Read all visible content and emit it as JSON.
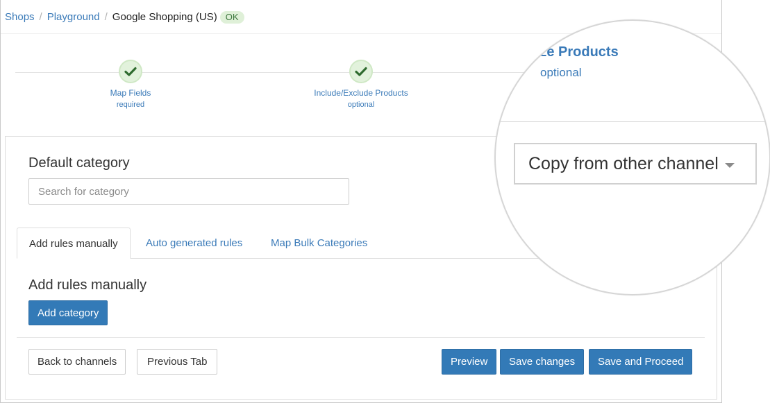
{
  "breadcrumb": {
    "items": [
      "Shops",
      "Playground"
    ],
    "separator": "/",
    "current": "Google Shopping (US)",
    "status_badge": "OK"
  },
  "steps": [
    {
      "label": "Map Fields",
      "sub": "required",
      "status": "complete",
      "icon": "check-icon"
    },
    {
      "label": "Include/Exclude Products",
      "sub": "optional",
      "status": "complete",
      "icon": "check-icon"
    }
  ],
  "magnifier": {
    "step_title": "rize Products",
    "step_sub": "optional",
    "copy_dropdown": "Copy from other channel"
  },
  "category": {
    "title": "Default category",
    "search_placeholder": "Search for category"
  },
  "tabs": [
    {
      "label": "Add rules manually",
      "active": true
    },
    {
      "label": "Auto generated rules",
      "active": false
    },
    {
      "label": "Map Bulk Categories",
      "active": false
    }
  ],
  "rules": {
    "title": "Add rules manually",
    "add_button": "Add category"
  },
  "footer": {
    "back": "Back to channels",
    "previous": "Previous Tab",
    "preview": "Preview",
    "save": "Save changes",
    "save_proceed": "Save and Proceed"
  },
  "colors": {
    "link": "#3a7ab8",
    "primary": "#337ab7",
    "success_bg": "#dff0d8",
    "success_text": "#3c763d",
    "check": "#2f6b2f"
  }
}
